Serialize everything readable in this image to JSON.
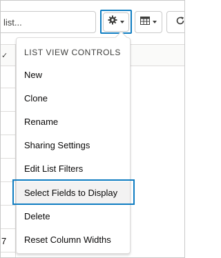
{
  "toolbar": {
    "search_value": "list...",
    "gear_icon": "gear-icon",
    "table_icon": "table-icon",
    "refresh_icon": "refresh-icon"
  },
  "grid": {
    "header_check": "✓",
    "row_number": "7"
  },
  "dropdown": {
    "header": "LIST VIEW CONTROLS",
    "items": [
      {
        "label": "New"
      },
      {
        "label": "Clone"
      },
      {
        "label": "Rename"
      },
      {
        "label": "Sharing Settings"
      },
      {
        "label": "Edit List Filters"
      },
      {
        "label": "Select Fields to Display",
        "selected": true
      },
      {
        "label": "Delete"
      },
      {
        "label": "Reset Column Widths"
      }
    ]
  },
  "colors": {
    "highlight": "#0e7cc1",
    "border": "#c9c9c9",
    "hover_bg": "#f3f2f2"
  }
}
